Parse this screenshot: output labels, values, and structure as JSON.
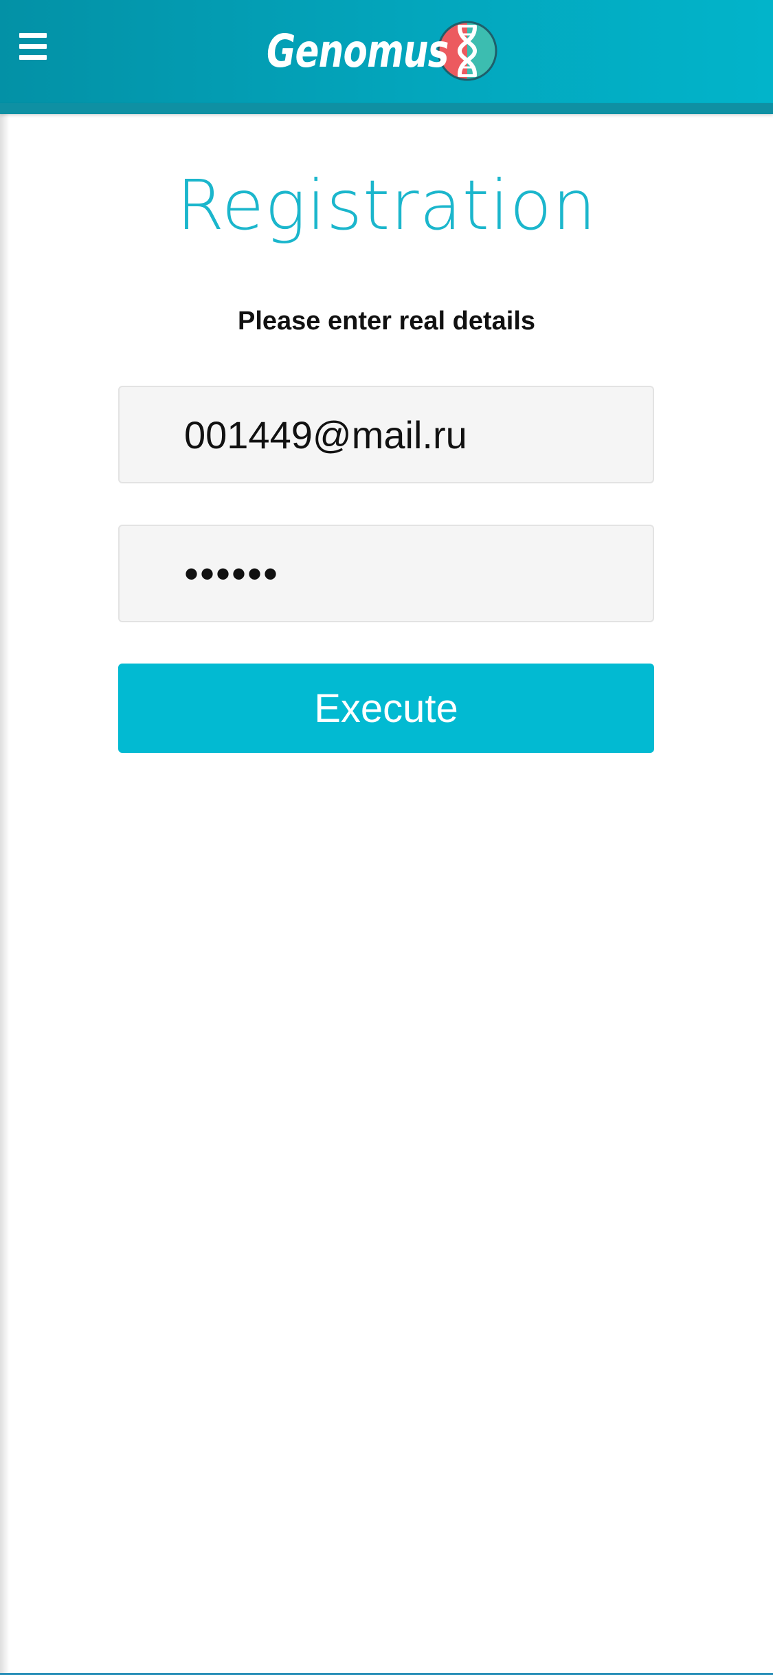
{
  "header": {
    "menu_icon": "hamburger-menu-icon",
    "logo_text": "Genomus",
    "logo_icon": "dna-helix-icon",
    "colors": {
      "bar_start": "#0391a6",
      "bar_end": "#02b4ca",
      "logo_red": "#ec5a5f",
      "logo_teal": "#3cbdb0"
    }
  },
  "page": {
    "title": "Registration",
    "subtitle": "Please enter real details"
  },
  "form": {
    "email": {
      "value": "001449@mail.ru"
    },
    "password": {
      "value": "••••••"
    },
    "submit_label": "Execute",
    "accent_color": "#02bad2"
  }
}
